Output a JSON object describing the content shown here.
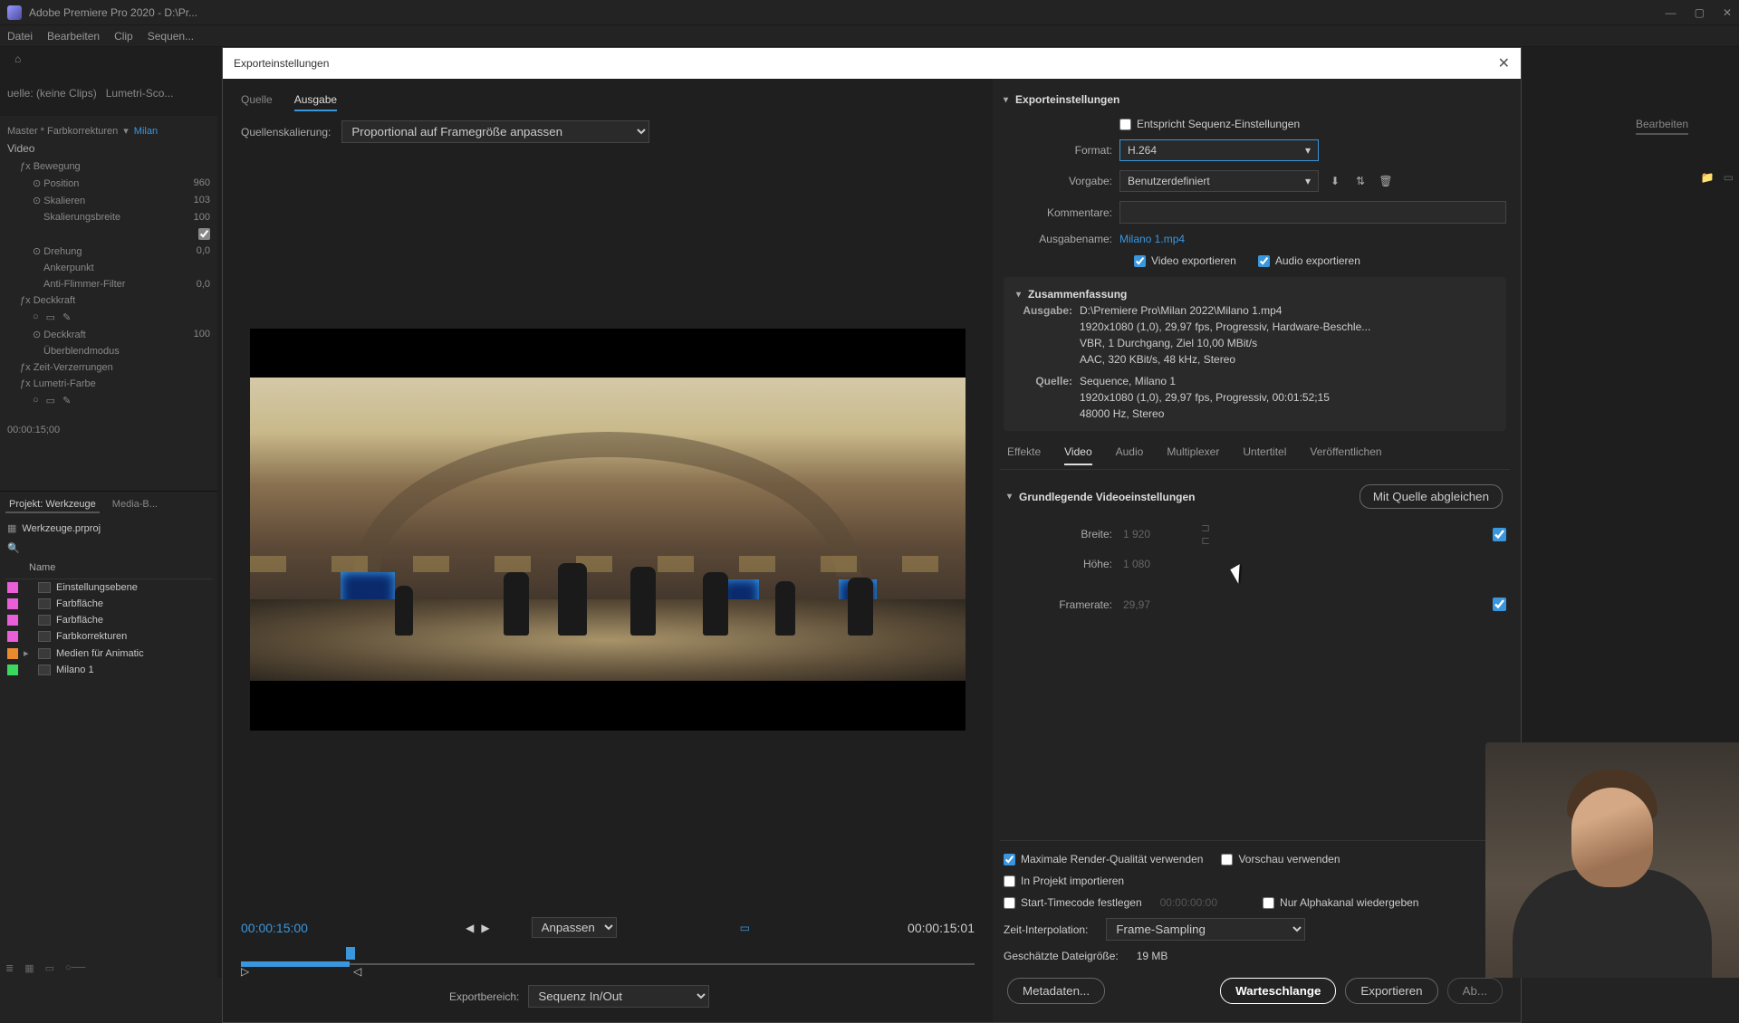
{
  "titlebar": {
    "title": "Adobe Premiere Pro 2020 - D:\\Pr..."
  },
  "menu": {
    "datei": "Datei",
    "bearbeiten": "Bearbeiten",
    "clip": "Clip",
    "sequenz": "Sequen..."
  },
  "bg": {
    "quelle": "uelle:  (keine Clips)",
    "lumetri": "Lumetri-Sco...",
    "master": "Master * Farbkorrekturen",
    "milan": "Milan",
    "video": "Video",
    "bewegung": "Bewegung",
    "position": "Position",
    "position_v": "960",
    "skalieren": "Skalieren",
    "skalieren_v": "103",
    "skalierbreite": "Skalierungsbreite",
    "skalierbreite_v": "100",
    "drehung": "Drehung",
    "drehung_v": "0,0",
    "ankerpunkt": "Ankerpunkt",
    "antiflimmer": "Anti-Flimmer-Filter",
    "antiflimmer_v": "0,0",
    "deckkraft": "Deckkraft",
    "deckkraft2": "Deckkraft",
    "deckkraft2_v": "100",
    "blend": "Überblendmodus",
    "zeit": "Zeit-Verzerrungen",
    "lumetrifarbe": "Lumetri-Farbe",
    "effekttime": "00:00:15;00",
    "projekt": "Projekt: Werkzeuge",
    "medienb": "Media-B...",
    "werkzeuge": "Werkzeuge.prproj",
    "name": "Name",
    "items": [
      {
        "c": "#e85fd8",
        "label": "Einstellungsebene"
      },
      {
        "c": "#e85fd8",
        "label": "Farbfläche"
      },
      {
        "c": "#e85fd8",
        "label": "Farbfläche"
      },
      {
        "c": "#e85fd8",
        "label": "Farbkorrekturen"
      },
      {
        "c": "#e88a2e",
        "label": "Medien für Animatic"
      },
      {
        "c": "#3ad85f",
        "label": "Milano 1"
      }
    ],
    "right_tab": "Bearbeiten"
  },
  "dialog": {
    "title": "Exporteinstellungen",
    "tabs": {
      "quelle": "Quelle",
      "ausgabe": "Ausgabe"
    },
    "scaling_label": "Quellenskalierung:",
    "scaling_value": "Proportional auf Framegröße anpassen",
    "timecode_left": "00:00:15:00",
    "timecode_right": "00:00:15:01",
    "fit_label": "Anpassen",
    "export_range_label": "Exportbereich:",
    "export_range_value": "Sequenz In/Out",
    "settings_header": "Exporteinstellungen",
    "match_sequence": "Entspricht Sequenz-Einstellungen",
    "format_label": "Format:",
    "format_value": "H.264",
    "preset_label": "Vorgabe:",
    "preset_value": "Benutzerdefiniert",
    "comments_label": "Kommentare:",
    "output_label": "Ausgabename:",
    "output_value": "Milano 1.mp4",
    "video_export": "Video exportieren",
    "audio_export": "Audio exportieren",
    "summary_header": "Zusammenfassung",
    "summary": {
      "ausgabe_label": "Ausgabe:",
      "ausgabe_l1": "D:\\Premiere Pro\\Milan 2022\\Milano 1.mp4",
      "ausgabe_l2": "1920x1080 (1,0), 29,97 fps, Progressiv, Hardware-Beschle...",
      "ausgabe_l3": "VBR, 1 Durchgang, Ziel 10,00 MBit/s",
      "ausgabe_l4": "AAC, 320 KBit/s, 48 kHz, Stereo",
      "quelle_label": "Quelle:",
      "quelle_l1": "Sequence, Milano 1",
      "quelle_l2": "1920x1080 (1,0), 29,97 fps, Progressiv, 00:01:52;15",
      "quelle_l3": "48000 Hz, Stereo"
    },
    "stabs": {
      "effekte": "Effekte",
      "video": "Video",
      "audio": "Audio",
      "multiplexer": "Multiplexer",
      "untertitel": "Untertitel",
      "veroeff": "Veröffentlichen"
    },
    "video_section": "Grundlegende Videoeinstellungen",
    "match_source": "Mit Quelle abgleichen",
    "breite_label": "Breite:",
    "breite_val": "1 920",
    "hoehe_label": "Höhe:",
    "hoehe_val": "1 080",
    "framerate_label": "Framerate:",
    "framerate_val": "29,97",
    "max_render": "Maximale Render-Qualität verwenden",
    "vorschau": "Vorschau verwenden",
    "import_proj": "In Projekt importieren",
    "start_tc": "Start-Timecode festlegen",
    "start_tc_val": "00:00:00:00",
    "alpha_only": "Nur Alphakanal wiedergeben",
    "zeit_interp_label": "Zeit-Interpolation:",
    "zeit_interp_val": "Frame-Sampling",
    "filesize_label": "Geschätzte Dateigröße:",
    "filesize_val": "19 MB",
    "btn_metadata": "Metadaten...",
    "btn_queue": "Warteschlange",
    "btn_export": "Exportieren",
    "btn_cancel": "Ab..."
  }
}
